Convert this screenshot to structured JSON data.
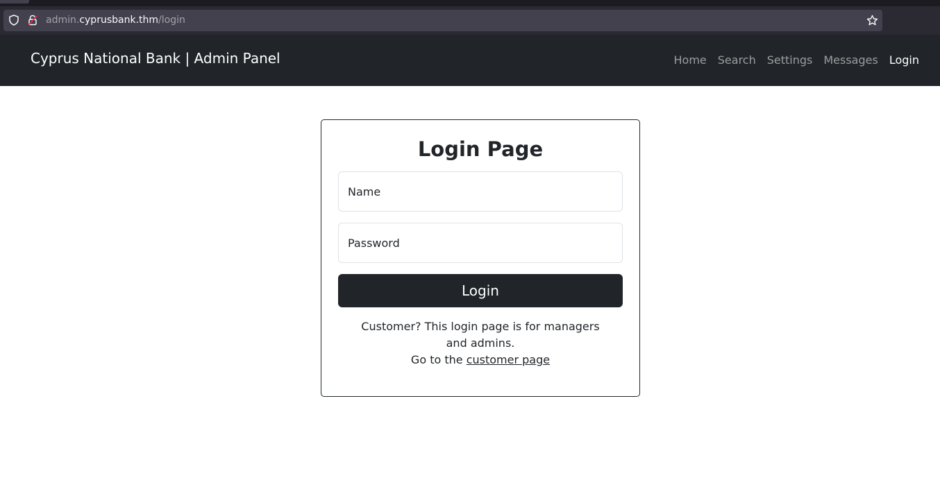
{
  "browser": {
    "url_prefix": "admin.",
    "url_host": "cyprusbank.thm",
    "url_path": "/login"
  },
  "navbar": {
    "brand": "Cyprus National Bank | Admin Panel",
    "links": [
      {
        "label": "Home",
        "active": false
      },
      {
        "label": "Search",
        "active": false
      },
      {
        "label": "Settings",
        "active": false
      },
      {
        "label": "Messages",
        "active": false
      },
      {
        "label": "Login",
        "active": true
      }
    ]
  },
  "login": {
    "title": "Login Page",
    "name_placeholder": "Name",
    "password_placeholder": "Password",
    "button_label": "Login",
    "note_line1": "Customer? This login page is for managers and admins.",
    "note_prefix": "Go to the ",
    "note_link": "customer page"
  },
  "colors": {
    "navbar_bg": "#212529",
    "button_bg": "#212529",
    "chrome_bg": "#2b2a33"
  },
  "icons": {
    "shield": "shield-icon",
    "lock": "lock-insecure-icon",
    "star": "bookmark-star-icon"
  }
}
